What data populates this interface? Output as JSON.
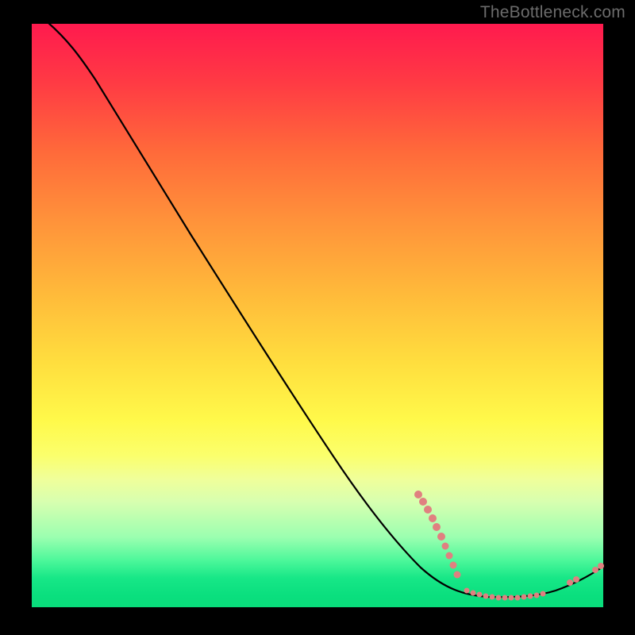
{
  "watermark": "TheBottleneck.com",
  "colors": {
    "background": "#000000",
    "curve": "#000000",
    "dots": "#e08080",
    "gradient_top": "#ff1a4e",
    "gradient_bottom": "#09dd7b"
  },
  "chart_data": {
    "type": "line",
    "title": "",
    "xlabel": "",
    "ylabel": "",
    "xlim": [
      0,
      100
    ],
    "ylim": [
      0,
      100
    ],
    "x": [
      0,
      4,
      8,
      12,
      16,
      20,
      24,
      28,
      32,
      36,
      40,
      44,
      48,
      52,
      56,
      60,
      64,
      68,
      72,
      76,
      80,
      84,
      88,
      92,
      96,
      100
    ],
    "y": [
      100,
      99,
      97,
      94,
      90,
      85,
      79,
      73,
      67,
      61,
      55,
      49,
      43,
      37,
      31,
      25,
      20,
      15,
      11,
      7,
      4,
      2,
      1,
      1,
      3,
      6
    ],
    "marker_clusters": [
      {
        "x_range": [
          68,
          76
        ],
        "y_range": [
          8,
          18
        ],
        "count": 10,
        "label": "descending-segment-dots"
      },
      {
        "x_range": [
          78,
          90
        ],
        "y_range": [
          1,
          3
        ],
        "count": 14,
        "label": "valley-floor-dots"
      },
      {
        "x_range": [
          94,
          100
        ],
        "y_range": [
          2,
          6
        ],
        "count": 4,
        "label": "right-tail-dots"
      }
    ]
  }
}
